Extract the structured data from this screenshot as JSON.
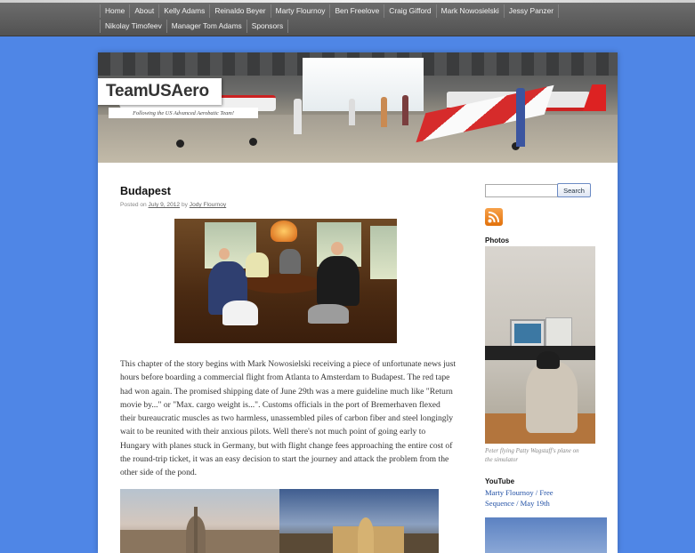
{
  "nav": {
    "row1": [
      "Home",
      "About",
      "Kelly Adams",
      "Reinaldo Beyer",
      "Marty Flournoy",
      "Ben Freelove",
      "Craig Gifford",
      "Mark Nowosielski",
      "Jessy Panzer"
    ],
    "row2": [
      "Nikolay Timofeev",
      "Manager Tom Adams",
      "Sponsors"
    ]
  },
  "site": {
    "title": "TeamUSAero",
    "tagline": "Following the US Advanced Aerobatic Team!"
  },
  "post": {
    "title": "Budapest",
    "posted_on": "Posted on",
    "date": "July 9, 2012",
    "by": "by",
    "author": "Jody Flournoy",
    "body": "This chapter of the story begins with Mark Nowosielski receiving a piece of unfortunate news just hours before boarding a commercial flight from Atlanta to Amsterdam to Budapest. The red tape had won again. The promised shipping date of June 29th was a mere guideline much like \"Return movie by...\" or \"Max. cargo weight is...\". Customs officials in the port of Bremerhaven flexed their bureaucratic muscles as two harmless, unassembled piles of carbon fiber and steel longingly wait to be reunited with their anxious pilots. Well there's not much point of going early to Hungary with planes stuck in Germany, but with flight change fees approaching the entire cost of the round-trip ticket, it was an easy decision to start the journey and attack the problem from the other side of the pond."
  },
  "sidebar": {
    "search_button": "Search",
    "photos_heading": "Photos",
    "photo_caption": "Peter flying Patty Wagstaff's plane on the simulator",
    "youtube_heading": "YouTube",
    "youtube_link": "Marty Flournoy / Free Sequence / May 19th"
  },
  "colors": {
    "background": "#4f86e6",
    "nav_bar": "#5e5e5e",
    "link": "#2452a6",
    "rss": "#e2710b"
  }
}
